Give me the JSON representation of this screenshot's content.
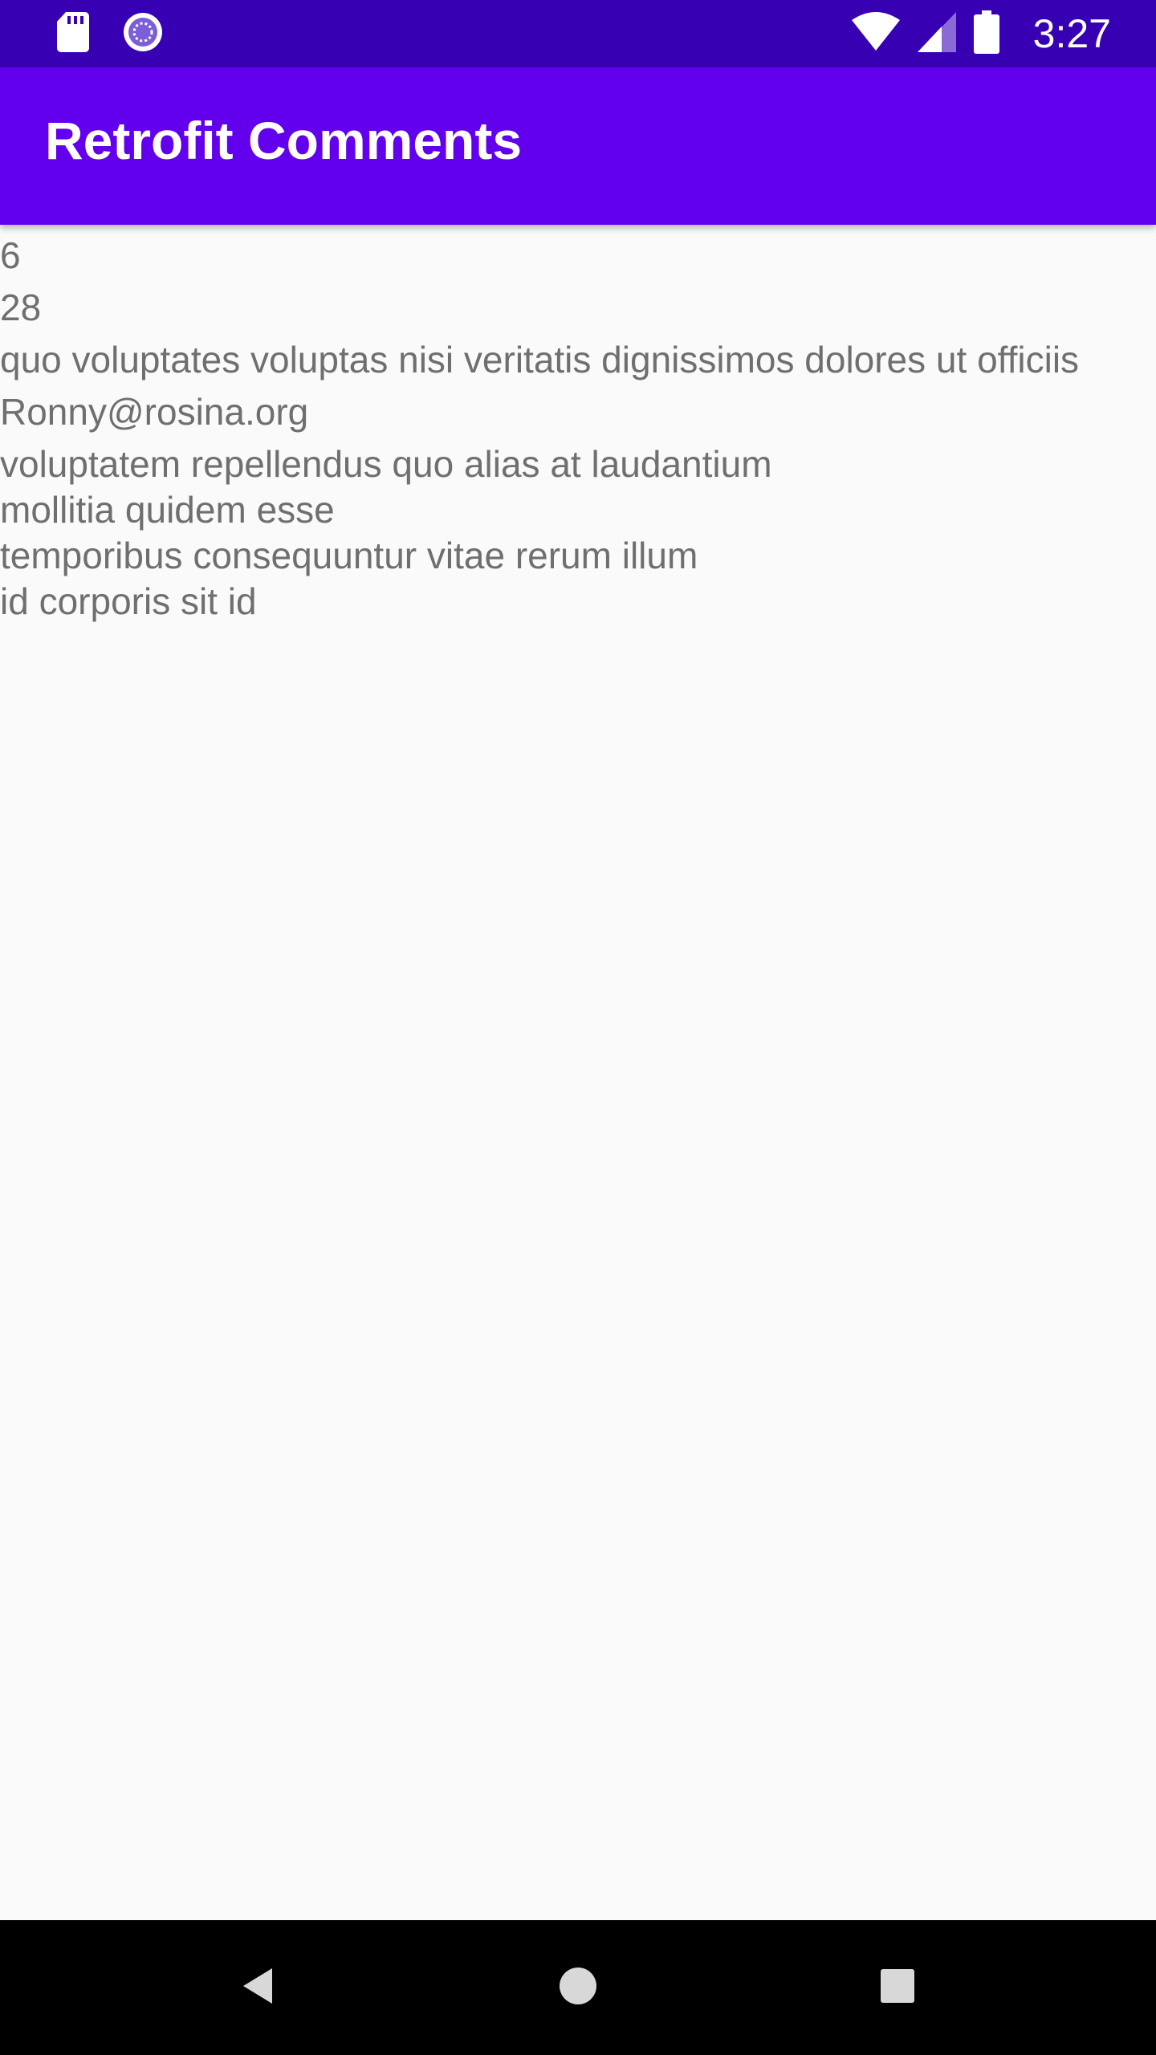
{
  "status_bar": {
    "time": "3:27",
    "left_icons": [
      "sd-card-icon",
      "sync-progress-icon"
    ],
    "right_icons": [
      "wifi-icon",
      "cellular-signal-icon",
      "battery-icon"
    ],
    "background": "#3700b3"
  },
  "app_bar": {
    "title": "Retrofit Comments",
    "background": "#6200ee"
  },
  "comment": {
    "post_id": "6",
    "id": "28",
    "name": "quo voluptates voluptas nisi veritatis dignissimos dolores ut officiis",
    "email": "Ronny@rosina.org",
    "body": "voluptatem repellendus quo alias at laudantium\nmollitia quidem esse\ntemporibus consequuntur vitae rerum illum\nid corporis sit id"
  },
  "nav_bar": {
    "buttons": [
      "back-icon",
      "home-icon",
      "recents-icon"
    ]
  },
  "colors": {
    "text": "#6f6f6f",
    "page_background": "#fafafa"
  }
}
